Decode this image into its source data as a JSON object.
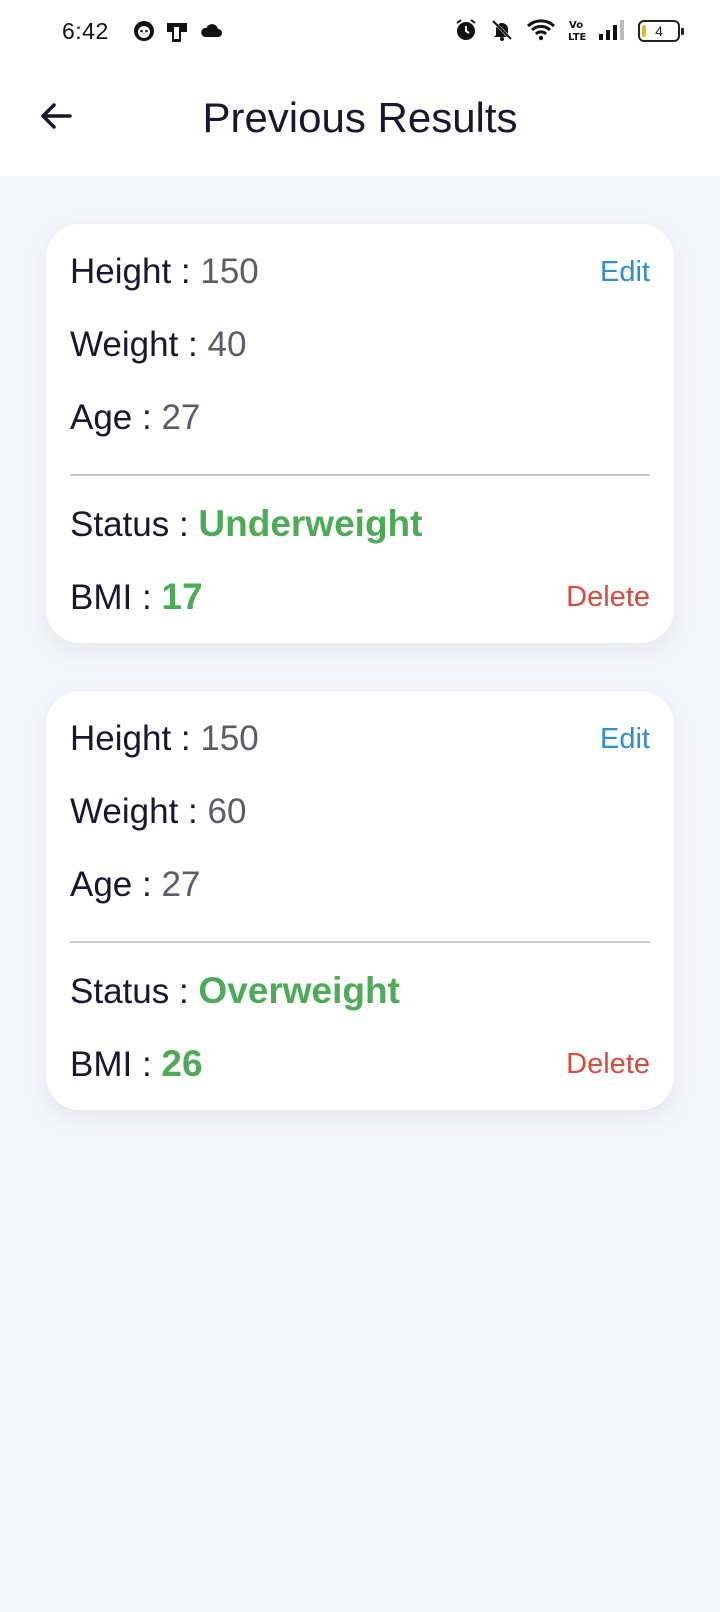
{
  "status_bar": {
    "time": "6:42",
    "battery": "4",
    "left_icons": [
      "face-notification-icon",
      "sim-card-icon",
      "cloud-icon"
    ],
    "right_icons": [
      "alarm-icon",
      "mute-bell-icon",
      "wifi-icon",
      "volte-icon",
      "signal-icon",
      "battery-icon"
    ]
  },
  "header": {
    "title": "Previous Results",
    "back_icon": "arrow-left-icon"
  },
  "labels": {
    "height": "Height : ",
    "weight": "Weight : ",
    "age": "Age : ",
    "status": "Status : ",
    "bmi": "BMI : ",
    "edit": "Edit",
    "delete": "Delete"
  },
  "results": [
    {
      "height": "150",
      "weight": "40",
      "age": "27",
      "status": "Underweight",
      "bmi": "17"
    },
    {
      "height": "150",
      "weight": "60",
      "age": "27",
      "status": "Overweight",
      "bmi": "26"
    }
  ],
  "colors": {
    "edit": "#2f8bd3",
    "delete": "#d84a3c",
    "status": "#4daa57",
    "background": "#f5f6fb"
  }
}
